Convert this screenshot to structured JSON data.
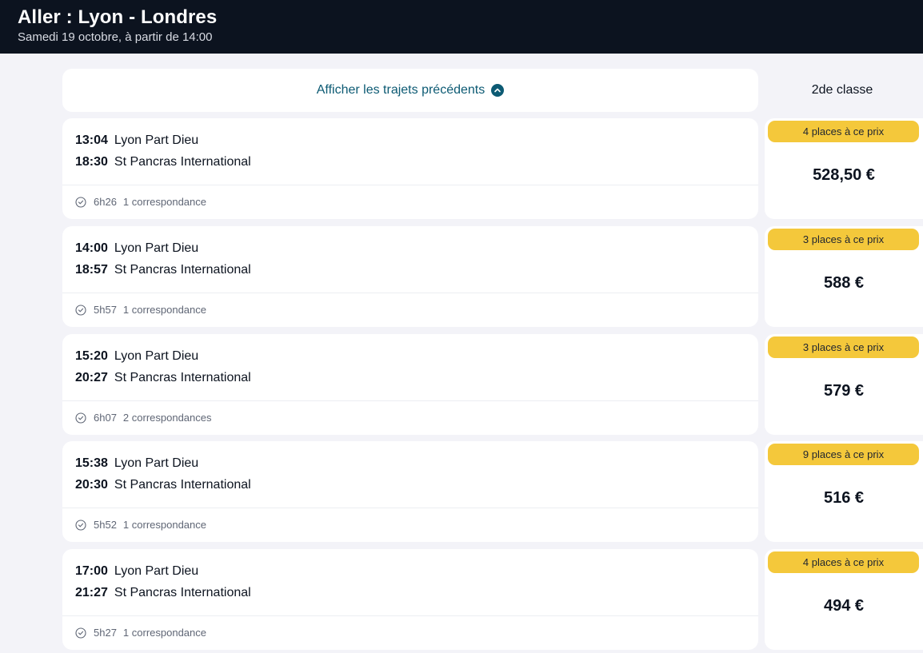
{
  "header": {
    "title": "Aller : Lyon - Londres",
    "subtitle": "Samedi 19 octobre, à partir de 14:00"
  },
  "previous": {
    "label": "Afficher les trajets précédents",
    "icon": "chevron-up-icon"
  },
  "fare_class": "2de classe",
  "colors": {
    "header_bg": "#0c131f",
    "accent": "#0c5a73",
    "badge": "#f4c83b",
    "page_bg": "#f3f3f8"
  },
  "journeys": [
    {
      "dep_time": "13:04",
      "dep_station": "Lyon Part Dieu",
      "arr_time": "18:30",
      "arr_station": "St Pancras International",
      "duration": "6h26",
      "connections": "1 correspondance",
      "badge": "4 places à ce prix",
      "price": "528,50 €"
    },
    {
      "dep_time": "14:00",
      "dep_station": "Lyon Part Dieu",
      "arr_time": "18:57",
      "arr_station": "St Pancras International",
      "duration": "5h57",
      "connections": "1 correspondance",
      "badge": "3 places à ce prix",
      "price": "588 €"
    },
    {
      "dep_time": "15:20",
      "dep_station": "Lyon Part Dieu",
      "arr_time": "20:27",
      "arr_station": "St Pancras International",
      "duration": "6h07",
      "connections": "2 correspondances",
      "badge": "3 places à ce prix",
      "price": "579 €"
    },
    {
      "dep_time": "15:38",
      "dep_station": "Lyon Part Dieu",
      "arr_time": "20:30",
      "arr_station": "St Pancras International",
      "duration": "5h52",
      "connections": "1 correspondance",
      "badge": "9 places à ce prix",
      "price": "516 €"
    },
    {
      "dep_time": "17:00",
      "dep_station": "Lyon Part Dieu",
      "arr_time": "21:27",
      "arr_station": "St Pancras International",
      "duration": "5h27",
      "connections": "1 correspondance",
      "badge": "4 places à ce prix",
      "price": "494 €"
    }
  ]
}
